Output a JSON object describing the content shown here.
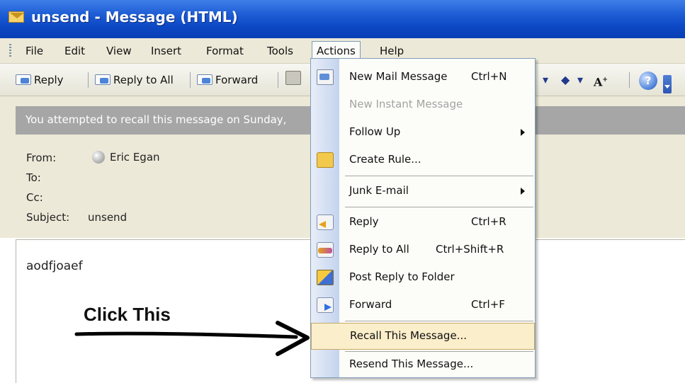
{
  "window": {
    "title": "unsend - Message (HTML)"
  },
  "menubar": {
    "items": [
      "File",
      "Edit",
      "View",
      "Insert",
      "Format",
      "Tools",
      "Actions",
      "Help"
    ],
    "active": "Actions"
  },
  "toolbar": {
    "reply_label": "Reply",
    "reply_all_label": "Reply to All",
    "forward_label": "Forward"
  },
  "infobar": {
    "text": "You attempted to recall this message on Sunday,"
  },
  "header": {
    "from_label": "From:",
    "from_value": "Eric Egan",
    "to_label": "To:",
    "cc_label": "Cc:",
    "subject_label": "Subject:",
    "subject_value": "unsend"
  },
  "body": {
    "text": "aodfjoaef"
  },
  "annotation": {
    "text": "Click This"
  },
  "actions_menu": {
    "items": [
      {
        "label": "New Mail Message",
        "shortcut": "Ctrl+N",
        "icon": "new-mail-icon"
      },
      {
        "label": "New Instant Message",
        "disabled": true
      },
      {
        "label": "Follow Up",
        "submenu": true
      },
      {
        "label": "Create Rule...",
        "icon": "create-rule-icon"
      },
      {
        "label": "Junk E-mail",
        "submenu": true
      },
      {
        "label": "Reply",
        "shortcut": "Ctrl+R",
        "icon": "reply-icon"
      },
      {
        "label": "Reply to All",
        "shortcut": "Ctrl+Shift+R",
        "icon": "reply-all-icon"
      },
      {
        "label": "Post Reply to Folder",
        "icon": "post-reply-icon"
      },
      {
        "label": "Forward",
        "shortcut": "Ctrl+F",
        "icon": "forward-icon"
      },
      {
        "label": "Recall This Message...",
        "highlighted": true
      },
      {
        "label": "Resend This Message..."
      }
    ]
  },
  "colors": {
    "title_bar": "#0c47c4",
    "info_bar": "#a6a6a6",
    "menu_highlight": "#fbeeca",
    "chrome": "#ece9d8"
  }
}
